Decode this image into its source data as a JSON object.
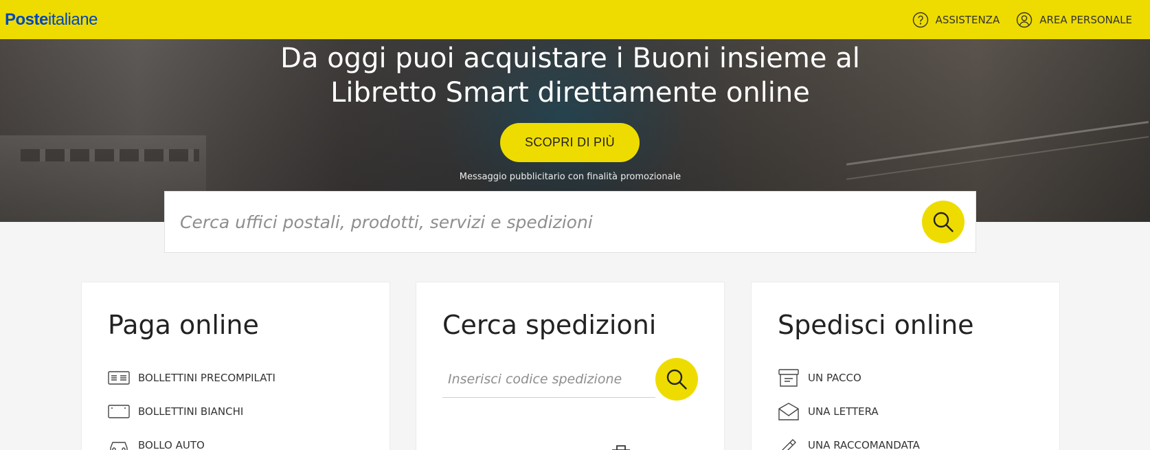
{
  "header": {
    "logo_bold": "Poste",
    "logo_light": "italiane",
    "nav": [
      {
        "label": "ASSISTENZA",
        "icon": "help-circle-icon"
      },
      {
        "label": "AREA PERSONALE",
        "icon": "user-circle-icon"
      }
    ]
  },
  "hero": {
    "title_line1": "Da oggi puoi acquistare i Buoni insieme al",
    "title_line2": "Libretto Smart direttamente online",
    "cta_label": "SCOPRI DI PIÙ",
    "disclaimer": "Messaggio pubblicitario con finalità promozionale"
  },
  "search": {
    "placeholder": "Cerca uffici postali, prodotti, servizi e spedizioni",
    "button_icon": "search-icon"
  },
  "cards": {
    "pay": {
      "title": "Paga online",
      "items": [
        {
          "label": "BOLLETTINI PRECOMPILATI",
          "icon": "prefilled-slip-icon"
        },
        {
          "label": "BOLLETTINI BIANCHI",
          "icon": "blank-slip-icon"
        },
        {
          "label": "BOLLO AUTO",
          "icon": "car-icon"
        }
      ]
    },
    "track": {
      "title": "Cerca spedizioni",
      "input_placeholder": "Inserisci codice spedizione",
      "button_icon": "search-icon"
    },
    "ship": {
      "title": "Spedisci online",
      "items": [
        {
          "label": "UN PACCO",
          "icon": "package-box-icon"
        },
        {
          "label": "UNA LETTERA",
          "icon": "envelope-icon"
        },
        {
          "label": "UNA RACCOMANDATA",
          "icon": "registered-mail-icon"
        }
      ]
    }
  },
  "colors": {
    "brand_yellow": "#eedc00",
    "brand_blue": "#0047bb",
    "page_bg": "#f5f5f5"
  }
}
